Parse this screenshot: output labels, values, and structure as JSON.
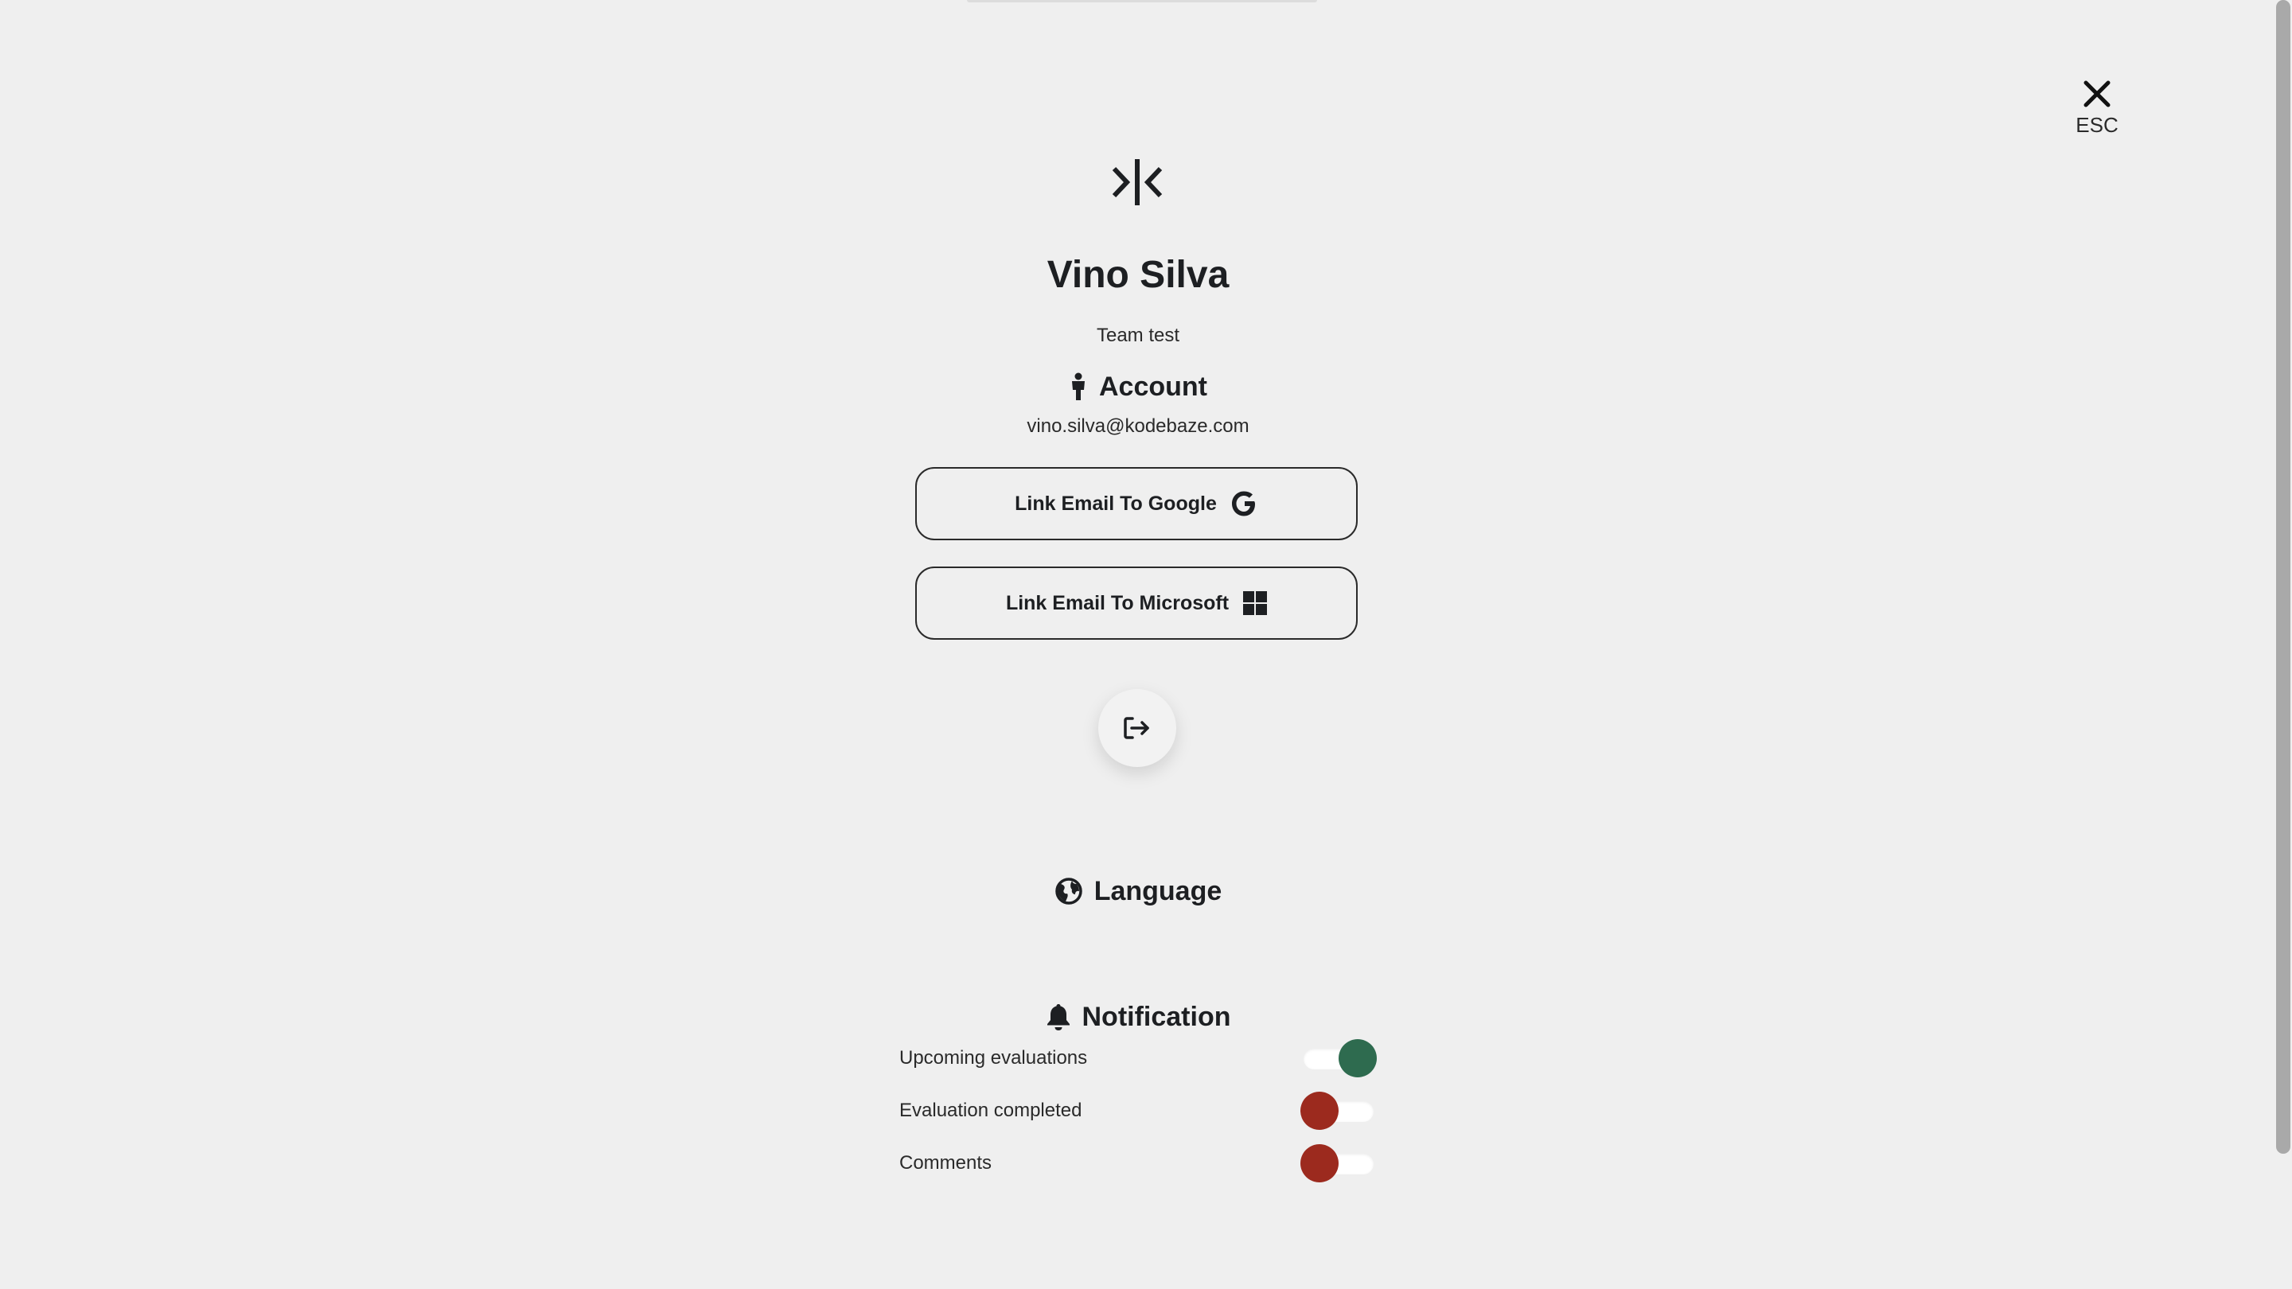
{
  "dialog": {
    "close_label": "ESC"
  },
  "profile": {
    "name": "Vino Silva",
    "team": "Team test"
  },
  "account": {
    "title": "Account",
    "email": "vino.silva@kodebaze.com",
    "link_google_label": "Link Email To Google",
    "link_microsoft_label": "Link Email To Microsoft"
  },
  "language": {
    "title": "Language"
  },
  "notification": {
    "title": "Notification",
    "items": [
      {
        "label": "Upcoming evaluations",
        "enabled": true
      },
      {
        "label": "Evaluation completed",
        "enabled": false
      },
      {
        "label": "Comments",
        "enabled": false
      }
    ]
  },
  "colors": {
    "toggle_on": "#2e6b4f",
    "toggle_off": "#9c2a1e",
    "text": "#1d1f22",
    "background": "#efefef"
  },
  "icons": {
    "logo": "brand-logo",
    "close": "close-icon",
    "account": "person-icon",
    "google": "google-icon",
    "microsoft": "windows-icon",
    "logout": "logout-icon",
    "language": "globe-icon",
    "notification": "bell-icon"
  }
}
